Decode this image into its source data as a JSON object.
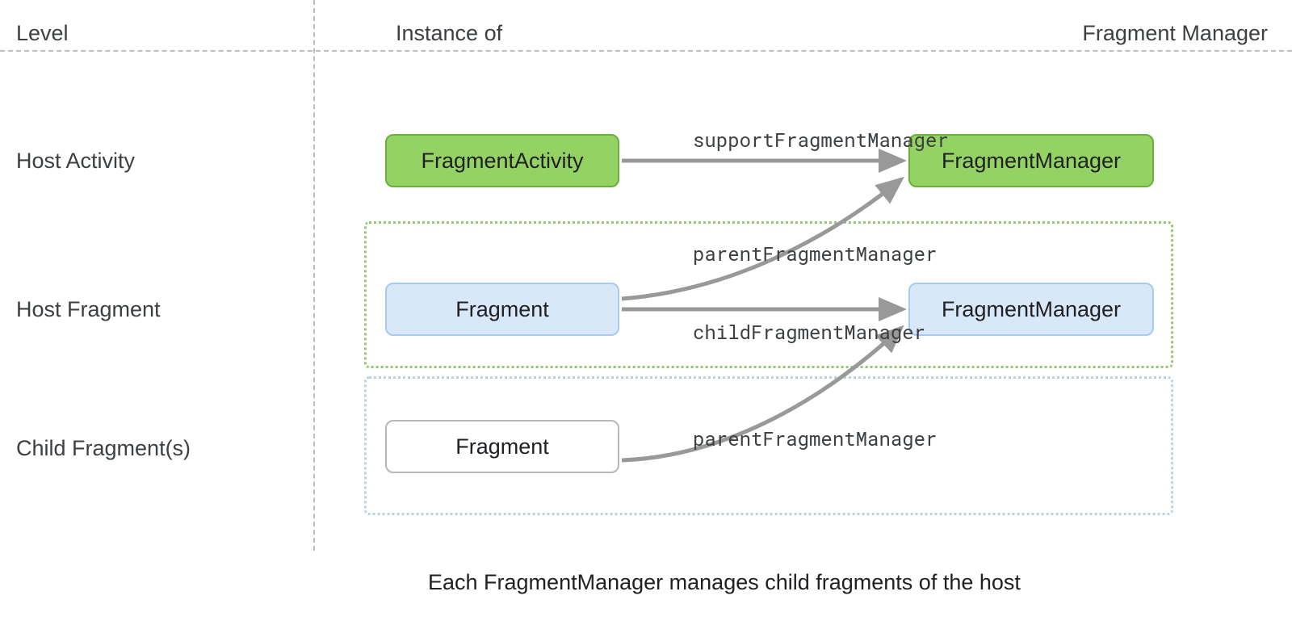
{
  "headers": {
    "level": "Level",
    "instance": "Instance of",
    "fm": "Fragment Manager"
  },
  "levels": {
    "host_activity": "Host Activity",
    "host_fragment": "Host Fragment",
    "child_fragments": "Child Fragment(s)"
  },
  "boxes": {
    "fragment_activity": "FragmentActivity",
    "fragment_manager_1": "FragmentManager",
    "fragment": "Fragment",
    "fragment_manager_2": "FragmentManager",
    "child_fragment": "Fragment"
  },
  "edges": {
    "support_fm": "supportFragmentManager",
    "parent_fm_1": "parentFragmentManager",
    "child_fm": "childFragmentManager",
    "parent_fm_2": "parentFragmentManager"
  },
  "caption": "Each FragmentManager manages child fragments of the host",
  "colors": {
    "green_fill": "#93d263",
    "green_border": "#6ab13c",
    "blue_fill": "#d8e8f8",
    "blue_border": "#a7cbee",
    "arrow": "#999999"
  }
}
